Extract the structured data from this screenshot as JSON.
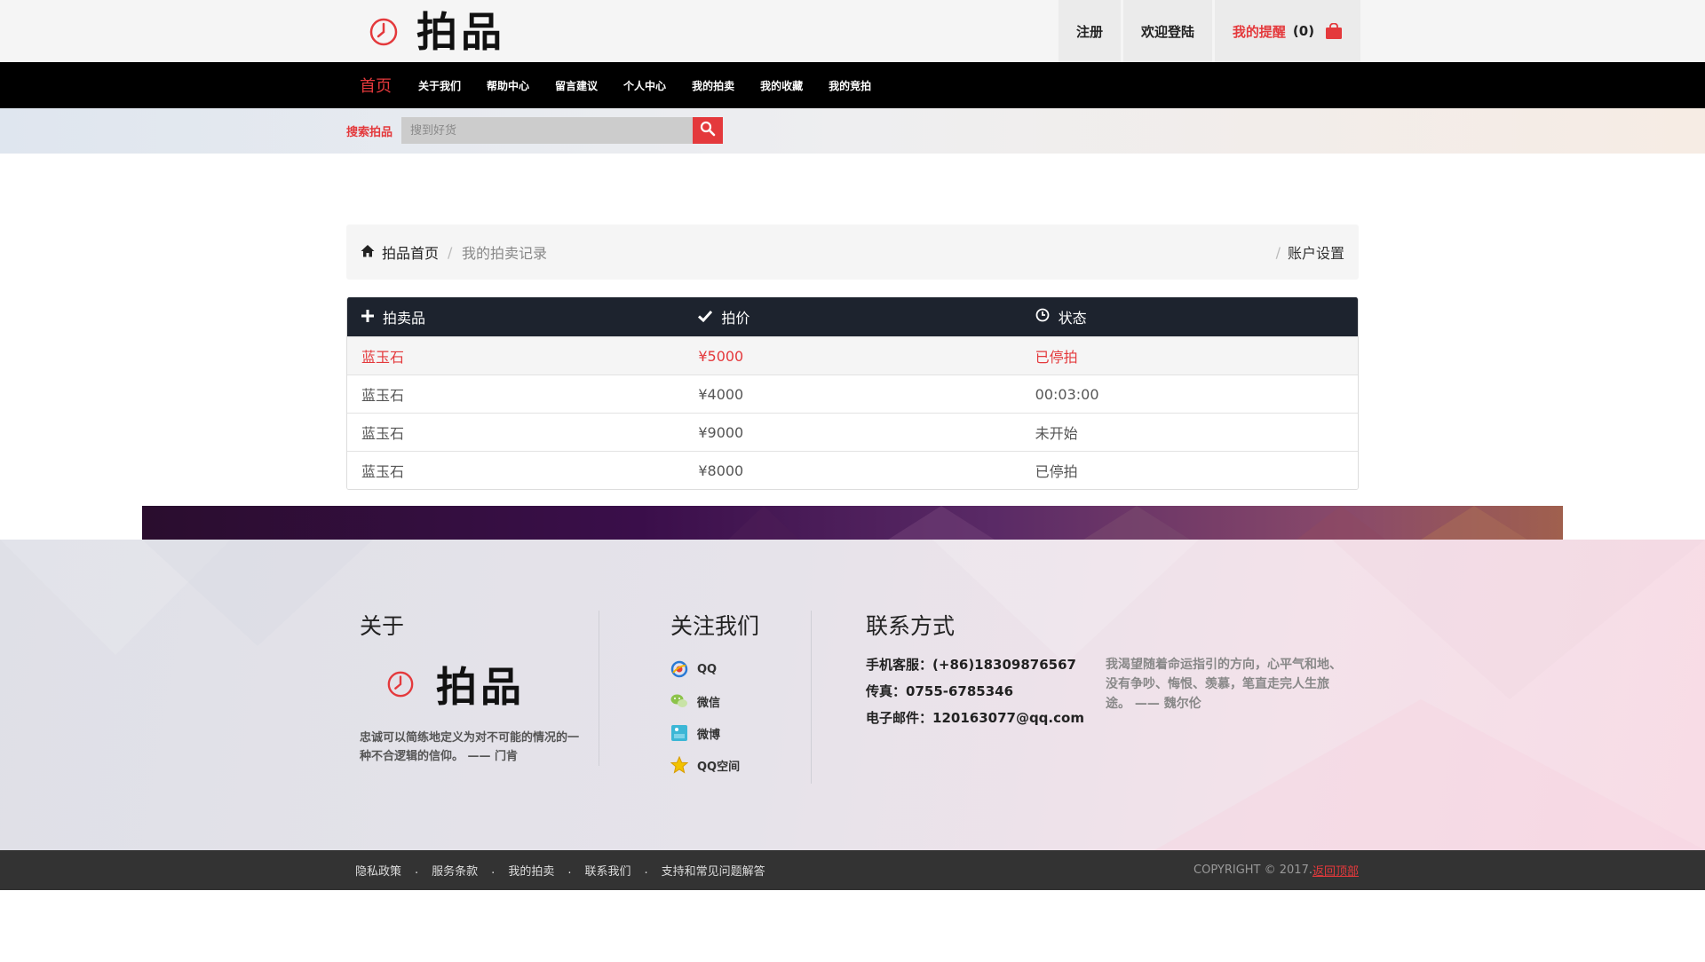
{
  "header": {
    "brand": "拍品",
    "register_label": "注册",
    "login_label": "欢迎登陆",
    "remind_label": "我的提醒",
    "remind_count": "(0)"
  },
  "nav": {
    "items": [
      "首页",
      "关于我们",
      "帮助中心",
      "留言建议",
      "个人中心",
      "我的拍卖",
      "我的收藏",
      "我的竞拍"
    ]
  },
  "search": {
    "label": "搜索拍品",
    "placeholder": "搜到好货"
  },
  "breadcrumb": {
    "home": "拍品首页",
    "separator": "/",
    "current": "我的拍卖记录",
    "account": "账户设置"
  },
  "table": {
    "headers": [
      "拍卖品",
      "拍价",
      "状态"
    ],
    "rows": [
      [
        "蓝玉石",
        "¥5000",
        "已停拍"
      ],
      [
        "蓝玉石",
        "¥4000",
        "00:03:00"
      ],
      [
        "蓝玉石",
        "¥9000",
        "未开始"
      ],
      [
        "蓝玉石",
        "¥8000",
        "已停拍"
      ]
    ]
  },
  "footer": {
    "about_title": "关于",
    "brand": "拍品",
    "about_quote": "忠诚可以简练地定义为对不可能的情况的一种不合逻辑的信仰。 —— 门肯",
    "follow_title": "关注我们",
    "social": [
      "QQ",
      "微信",
      "微博",
      "QQ空间"
    ],
    "contact_title": "联系方式",
    "phone_label": "手机客服：",
    "phone": "(+86)18309876567",
    "fax_label": "传真：",
    "fax": "0755-6785346",
    "email_label": "电子邮件：",
    "email": "120163077@qq.com",
    "motto": "我渴望随着命运指引的方向，心平气和地、没有争吵、悔恨、羡慕，笔直走完人生旅途。 —— 魏尔伦"
  },
  "bottom": {
    "links": [
      "隐私政策",
      "服务条款",
      "我的拍卖",
      "联系我们",
      "支持和常见问题解答"
    ],
    "copyright": "COPYRIGHT © 2017.",
    "back_to_top": "返回顶部"
  },
  "colors": {
    "accent": "#e4393c",
    "nav_bg": "#000000",
    "table_header_bg": "#1d232e",
    "bottom_bar_bg": "#333333"
  }
}
